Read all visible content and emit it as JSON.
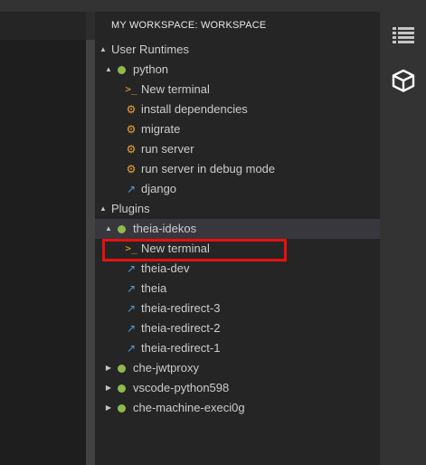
{
  "panel": {
    "title": "MY WORKSPACE: WORKSPACE"
  },
  "tree": {
    "user_runtimes": {
      "label": "User Runtimes",
      "python": {
        "label": "python",
        "status_color": "#8fb94b",
        "children": [
          {
            "label": "New terminal",
            "icon": "terminal-icon"
          },
          {
            "label": "install dependencies",
            "icon": "gears-icon"
          },
          {
            "label": "migrate",
            "icon": "gears-icon"
          },
          {
            "label": "run server",
            "icon": "gears-icon"
          },
          {
            "label": "run server in debug mode",
            "icon": "gears-icon"
          },
          {
            "label": "django",
            "icon": "external-link-icon"
          }
        ]
      }
    },
    "plugins": {
      "label": "Plugins",
      "theia_idekos": {
        "label": "theia-idekos",
        "status_color": "#8fb94b",
        "children": [
          {
            "label": "New terminal",
            "icon": "terminal-icon"
          },
          {
            "label": "theia-dev",
            "icon": "external-link-icon"
          },
          {
            "label": "theia",
            "icon": "external-link-icon"
          },
          {
            "label": "theia-redirect-3",
            "icon": "external-link-icon"
          },
          {
            "label": "theia-redirect-2",
            "icon": "external-link-icon"
          },
          {
            "label": "theia-redirect-1",
            "icon": "external-link-icon"
          }
        ]
      },
      "collapsed": [
        {
          "label": "che-jwtproxy",
          "status_color": "#8fb94b"
        },
        {
          "label": "vscode-python598",
          "status_color": "#8fb94b"
        },
        {
          "label": "che-machine-execi0g",
          "status_color": "#8fb94b"
        }
      ]
    }
  },
  "activity_bar": {
    "items": [
      {
        "name": "outline-icon"
      },
      {
        "name": "workspace-cube-icon"
      }
    ]
  },
  "colors": {
    "highlight": "#e81010",
    "terminal_icon": "#f0a030",
    "link_icon": "#4fa0e0"
  }
}
